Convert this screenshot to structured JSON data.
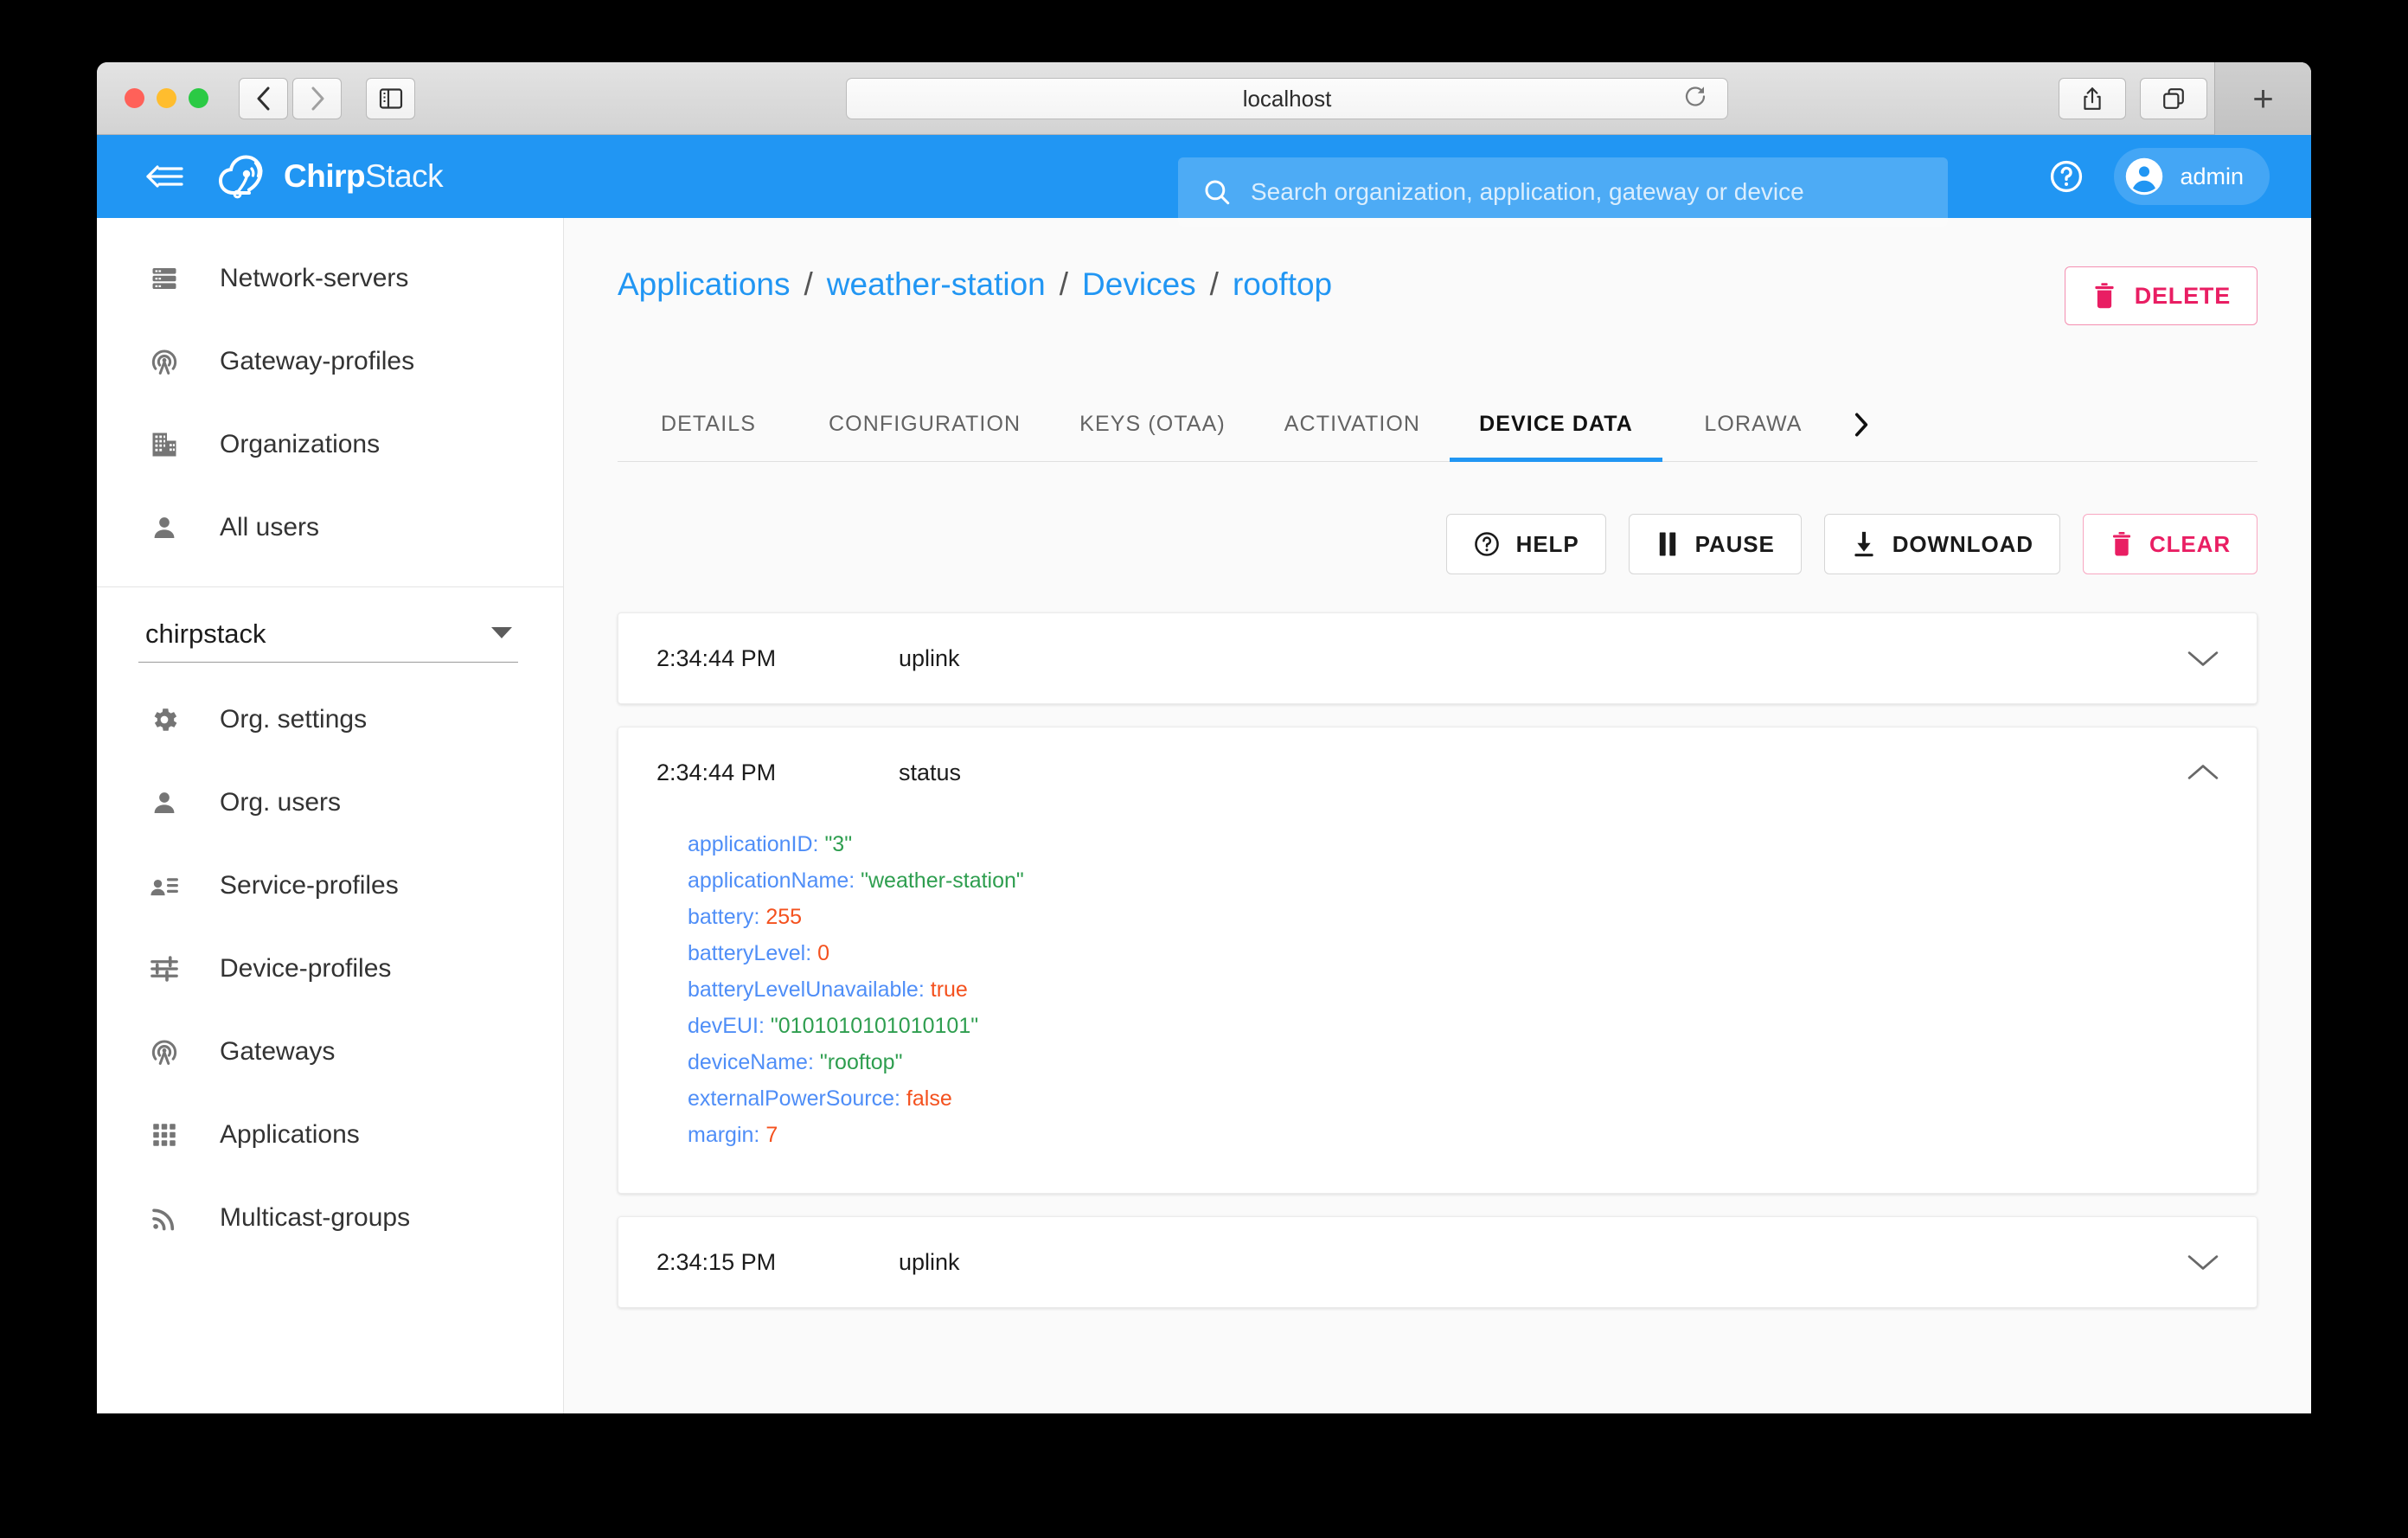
{
  "browser": {
    "url": "localhost",
    "back_icon": "chevron-left-icon",
    "forward_icon": "chevron-right-icon",
    "sidebar_icon": "sidebar-toggle-icon",
    "reload_icon": "reload-icon",
    "share_icon": "share-icon",
    "tabs_icon": "show-tabs-icon",
    "new_tab_label": "+"
  },
  "header": {
    "collapse_icon": "menu-collapse-icon",
    "brand_bold": "Chirp",
    "brand_light": "Stack",
    "logo_icon": "chirpstack-cloud-logo-icon",
    "search": {
      "placeholder": "Search organization, application, gateway or device",
      "value": "",
      "icon": "search-icon"
    },
    "help_icon": "help-circle-icon",
    "user": {
      "avatar_icon": "account-circle-icon",
      "label": "admin"
    },
    "accent_color": "#2196f3"
  },
  "sidebar": {
    "global_items": [
      {
        "label": "Network-servers",
        "icon": "server-rack-icon"
      },
      {
        "label": "Gateway-profiles",
        "icon": "antenna-broadcast-icon"
      },
      {
        "label": "Organizations",
        "icon": "office-building-icon"
      },
      {
        "label": "All users",
        "icon": "person-icon"
      }
    ],
    "org_select": {
      "value": "chirpstack",
      "caret_icon": "chevron-down-icon"
    },
    "org_items": [
      {
        "label": "Org. settings",
        "icon": "gear-icon"
      },
      {
        "label": "Org. users",
        "icon": "person-icon"
      },
      {
        "label": "Service-profiles",
        "icon": "person-list-icon"
      },
      {
        "label": "Device-profiles",
        "icon": "sliders-icon"
      },
      {
        "label": "Gateways",
        "icon": "antenna-broadcast-icon"
      },
      {
        "label": "Applications",
        "icon": "grid-apps-icon"
      },
      {
        "label": "Multicast-groups",
        "icon": "rss-broadcast-icon"
      }
    ]
  },
  "main": {
    "breadcrumb": [
      {
        "label": "Applications",
        "link": true
      },
      {
        "label": "weather-station",
        "link": true
      },
      {
        "label": "Devices",
        "link": true
      },
      {
        "label": "rooftop",
        "link": true
      }
    ],
    "breadcrumb_separator": "/",
    "delete_button": {
      "label": "DELETE",
      "icon": "trash-icon",
      "color": "#e91e63"
    },
    "tabs": [
      {
        "label": "DETAILS",
        "active": false
      },
      {
        "label": "CONFIGURATION",
        "active": false
      },
      {
        "label": "KEYS (OTAA)",
        "active": false
      },
      {
        "label": "ACTIVATION",
        "active": false
      },
      {
        "label": "DEVICE DATA",
        "active": true
      },
      {
        "label": "LORAWA",
        "active": false,
        "truncated": true
      }
    ],
    "tabs_next_icon": "chevron-right-icon",
    "toolbar": [
      {
        "label": "HELP",
        "icon": "help-circle-icon",
        "danger": false
      },
      {
        "label": "PAUSE",
        "icon": "pause-icon",
        "danger": false
      },
      {
        "label": "DOWNLOAD",
        "icon": "download-icon",
        "danger": false
      },
      {
        "label": "CLEAR",
        "icon": "trash-icon",
        "danger": true
      }
    ],
    "events": [
      {
        "time": "2:34:44 PM",
        "type": "uplink",
        "expanded": false,
        "chevron_icon": "chevron-down-icon",
        "fields": []
      },
      {
        "time": "2:34:44 PM",
        "type": "status",
        "expanded": true,
        "chevron_icon": "chevron-up-icon",
        "fields": [
          {
            "key": "applicationID",
            "value": "\"3\"",
            "kind": "string"
          },
          {
            "key": "applicationName",
            "value": "\"weather-station\"",
            "kind": "string"
          },
          {
            "key": "battery",
            "value": "255",
            "kind": "number"
          },
          {
            "key": "batteryLevel",
            "value": "0",
            "kind": "number"
          },
          {
            "key": "batteryLevelUnavailable",
            "value": "true",
            "kind": "bool"
          },
          {
            "key": "devEUI",
            "value": "\"0101010101010101\"",
            "kind": "string"
          },
          {
            "key": "deviceName",
            "value": "\"rooftop\"",
            "kind": "string"
          },
          {
            "key": "externalPowerSource",
            "value": "false",
            "kind": "bool"
          },
          {
            "key": "margin",
            "value": "7",
            "kind": "number"
          }
        ]
      },
      {
        "time": "2:34:15 PM",
        "type": "uplink",
        "expanded": false,
        "chevron_icon": "chevron-down-icon",
        "fields": []
      }
    ]
  },
  "colors": {
    "accent": "#2196f3",
    "danger": "#e91e63",
    "json_key": "#4f8ef7",
    "json_string": "#2e9e4f",
    "json_number": "#f4511e"
  }
}
